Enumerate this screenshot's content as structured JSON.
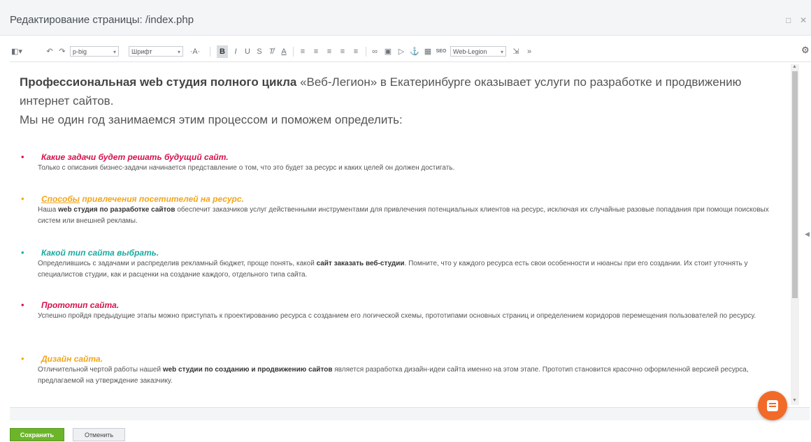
{
  "window": {
    "title": "Редактирование страницы: /index.php"
  },
  "toolbar": {
    "style_select": "p-big",
    "font_select": "Шрифт",
    "template_select": "Web-Legion",
    "more_label": "»"
  },
  "content": {
    "intro_bold": "Профессиональная web студия полного цикла",
    "intro_rest": " «Веб-Легион» в Екатеринбурге оказывает услуги по разработке и продвижению интернет сайтов.",
    "intro_line2": "Мы не один год занимаемся этим процессом и поможем определить:",
    "items": [
      {
        "title": "Какие задачи будет решать будущий сайт.",
        "color": "#d6114b",
        "text": "Только с описания бизнес-задачи начинается представление о том, что это будет за ресурс и каких целей он должен достигать."
      },
      {
        "title_underlined": "Способы",
        "title": " привлечения посетителей на ресурс.",
        "color": "#f3a51b",
        "text_pre": "Наша ",
        "text_bold": "web студия по разработке сайтов",
        "text_post": " обеспечит заказчиков услуг действенными инструментами для привлечения потенциальных клиентов на ресурс, исключая их случайные разовые попадания при помощи поисковых систем или внешней рекламы."
      },
      {
        "title": "Какой тип сайта выбрать.",
        "color": "#1aa9a0",
        "text_pre": "Определившись с задачами и распределив рекламный бюджет, проще понять, какой ",
        "text_bold": "сайт заказать веб-студии",
        "text_post": ". Помните, что у каждого ресурса есть свои особенности и нюансы при его создании. Их стоит уточнять у специалистов студии, как и расценки на создание каждого, отдельного типа сайта."
      },
      {
        "title": "Прототип сайта.",
        "color": "#d6114b",
        "text": "Успешно пройдя предыдущие этапы можно приступать к проектированию ресурса с созданием его логической схемы, прототипами основных страниц и определением коридоров перемещения пользователей по ресурсу."
      },
      {
        "title": "Дизайн сайта.",
        "color": "#f3a51b",
        "text_pre": "Отличительной чертой работы нашей ",
        "text_bold": "web студии по созданию и продвижению сайтов",
        "text_post": " является разработка дизайн-идеи сайта именно на этом этапе. Прототип становится красочно оформленной версией ресурса, предлагаемой на утверждение заказчику."
      }
    ]
  },
  "footer": {
    "save_label": "Сохранить",
    "cancel_label": "Отменить"
  },
  "colors": {
    "save_button": "#6cb52a",
    "fab": "#f26a28"
  }
}
